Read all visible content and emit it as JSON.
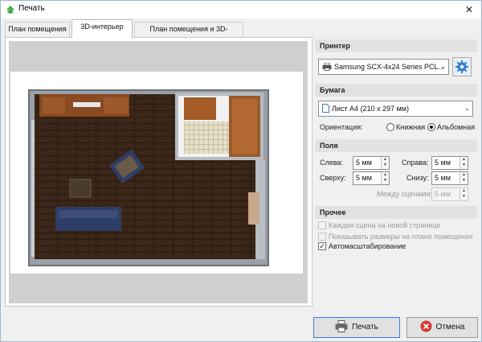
{
  "window": {
    "title": "Печать",
    "close_glyph": "✕"
  },
  "tabs": [
    {
      "label": "План помещения",
      "active": false
    },
    {
      "label": "3D-интерьер",
      "active": true
    },
    {
      "label": "План помещения и 3D-интерьер",
      "active": false
    }
  ],
  "printer": {
    "header": "Принтер",
    "selected": "Samsung SCX-4x24 Series PCL...",
    "settings_icon": "gear-icon"
  },
  "paper": {
    "header": "Бумага",
    "selected": "Лист A4 (210 x 297 мм)",
    "orientation_label": "Ориентация:",
    "portrait_label": "Книжная",
    "landscape_label": "Альбомная",
    "orientation": "landscape"
  },
  "margins": {
    "header": "Поля",
    "left_label": "Слева:",
    "left_value": "5 мм",
    "right_label": "Справа:",
    "right_value": "5 мм",
    "top_label": "Сверху:",
    "top_value": "5 мм",
    "bottom_label": "Снизу:",
    "bottom_value": "5 мм",
    "between_label": "Между сценами:",
    "between_value": "5 мм"
  },
  "other": {
    "header": "Прочее",
    "each_scene_label": "Каждая сцена на новой странице",
    "show_sizes_label": "Показывать размеры на плане помещения",
    "autoscale_label": "Автомасштабирование",
    "autoscale_checked": true
  },
  "buttons": {
    "print_label": "Печать",
    "cancel_label": "Отмена"
  },
  "colors": {
    "accent": "#3f7fd1",
    "floor": "#3a2618",
    "cabinet": "#8a4a22",
    "sofa": "#2f3e66",
    "cancel_icon": "#d43a2f"
  }
}
